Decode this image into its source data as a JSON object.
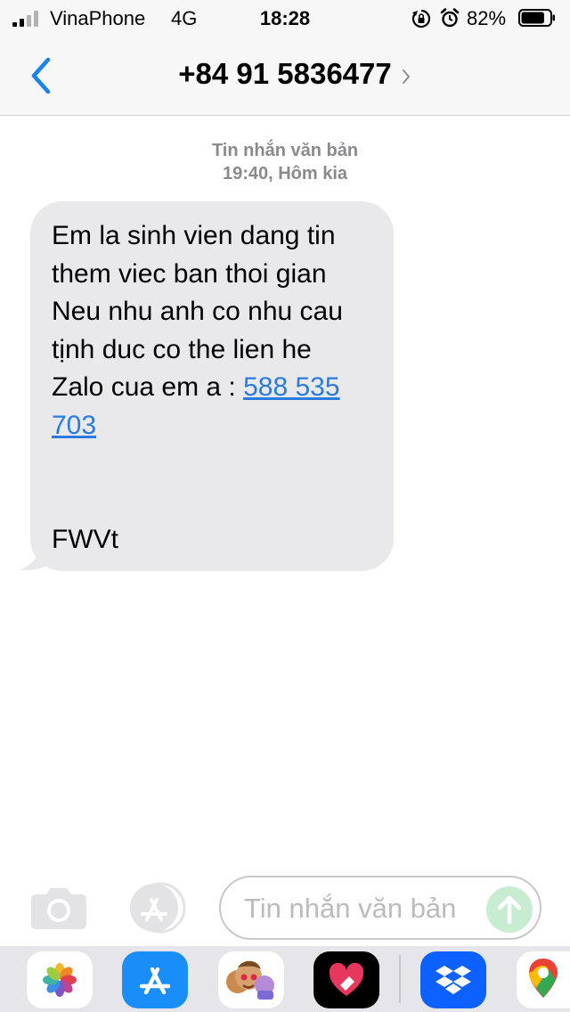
{
  "status_bar": {
    "carrier": "VinaPhone",
    "network": "4G",
    "time": "18:28",
    "battery": "82%",
    "battery_level": 0.82,
    "icons": [
      "signal-icon",
      "rotation-lock-icon",
      "alarm-icon",
      "battery-icon"
    ]
  },
  "header": {
    "contact": "+84 91 5836477",
    "icons": [
      "chevron-left-icon",
      "chevron-right-icon"
    ]
  },
  "conversation": {
    "meta_type": "Tin nhắn văn bản",
    "meta_time": "19:40, Hôm kia",
    "message": {
      "text": "Em la sinh vien dang tin\nthem viec ban thoi gian\nNeu nhu anh co nhu cau\ntịnh duc co the lien he\nZalo cua em a : ",
      "link": "588 535 703",
      "signature": "FWVt"
    }
  },
  "composer": {
    "placeholder": "Tin nhắn văn bản",
    "icons": [
      "camera-icon",
      "app-store-icon",
      "send-arrow-icon"
    ]
  },
  "app_drawer": {
    "apps": [
      "photos-icon",
      "app-store-icon",
      "memoji-icon",
      "digital-touch-icon",
      "dropbox-icon",
      "google-maps-icon"
    ]
  },
  "colors": {
    "link": "#2a7be0",
    "bubble": "#e9e9eb",
    "ios_blue": "#1a82f7",
    "send_disabled": "#c8ecd2"
  }
}
